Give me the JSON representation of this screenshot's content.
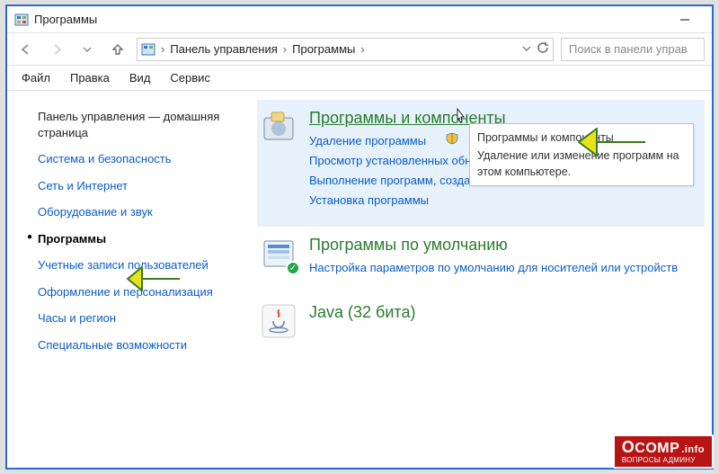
{
  "window": {
    "title": "Программы"
  },
  "breadcrumbs": {
    "root": "Панель управления",
    "mid": "Программы"
  },
  "search": {
    "placeholder": "Поиск в панели управ"
  },
  "menu": {
    "file": "Файл",
    "edit": "Правка",
    "view": "Вид",
    "tools": "Сервис"
  },
  "sidebar": {
    "items": [
      {
        "label": "Панель управления — домашняя страница",
        "plain": true
      },
      {
        "label": "Система и безопасность"
      },
      {
        "label": "Сеть и Интернет"
      },
      {
        "label": "Оборудование и звук"
      },
      {
        "label": "Программы",
        "active": true
      },
      {
        "label": "Учетные записи пользователей"
      },
      {
        "label": "Оформление и персонализация"
      },
      {
        "label": "Часы и регион"
      },
      {
        "label": "Специальные возможности"
      }
    ]
  },
  "sections": {
    "s1": {
      "title": "Программы и компоненты",
      "sub1": "Удаление программы",
      "sub2": "Просмотр установленных обно",
      "sub3": "Выполнение программ, создан",
      "sub4": "Установка программы"
    },
    "s2": {
      "title": "Программы по умолчанию",
      "sub1": "Настройка параметров по умолчанию для носителей или устройств"
    },
    "s3": {
      "title": "Java (32 бита)"
    }
  },
  "tooltip": {
    "title": "Программы и компоненты",
    "body": "Удаление или изменение программ на этом компьютере."
  },
  "watermark": {
    "brand_o": "O",
    "brand_rest": "COMP",
    "brand_info": ".info",
    "sub": "ВОПРОСЫ АДМИНУ"
  }
}
